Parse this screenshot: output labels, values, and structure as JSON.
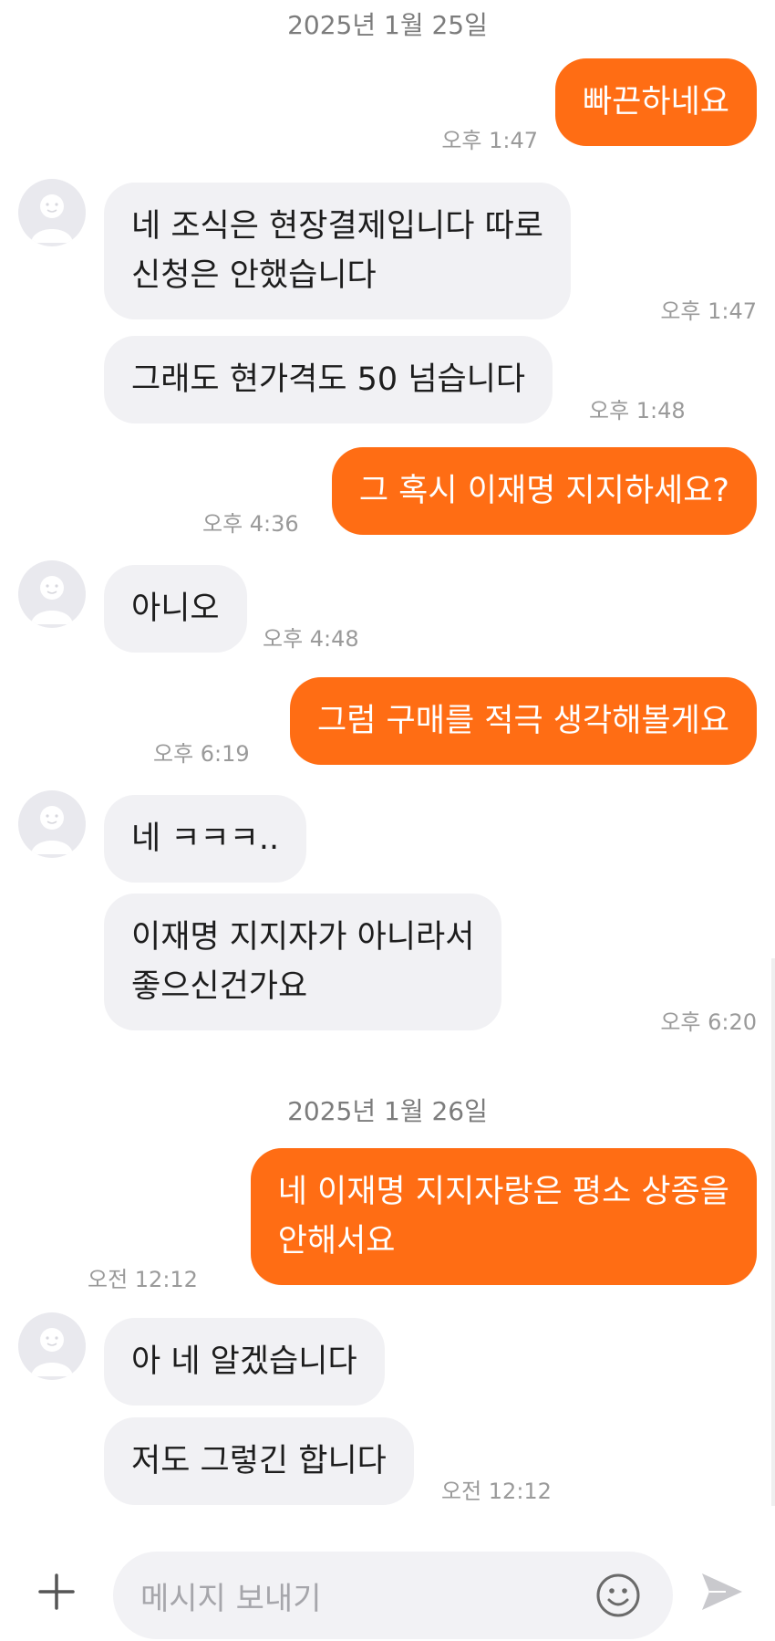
{
  "dates": {
    "first": "2025년 1월 25일",
    "second": "2025년 1월 26일"
  },
  "messages": [
    {
      "direction": "out",
      "text": "빠끈하네요",
      "time": "오후 1:47"
    },
    {
      "direction": "in",
      "text": "네 조식은 현장결제입니다 따로\n신청은 안했습니다",
      "time": "오후 1:47"
    },
    {
      "direction": "in",
      "text": "그래도 현가격도 50 넘습니다",
      "time": "오후 1:48"
    },
    {
      "direction": "out",
      "text": "그 혹시 이재명 지지하세요?",
      "time": "오후 4:36"
    },
    {
      "direction": "in",
      "text": "아니오",
      "time": "오후 4:48"
    },
    {
      "direction": "out",
      "text": "그럼 구매를 적극 생각해볼게요",
      "time": "오후 6:19"
    },
    {
      "direction": "in",
      "text": "네 ㅋㅋㅋ..",
      "time": ""
    },
    {
      "direction": "in",
      "text": "이재명 지지자가 아니라서\n좋으신건가요",
      "time": "오후 6:20"
    },
    {
      "direction": "out",
      "text": "네 이재명 지지자랑은 평소 상종을\n안해서요",
      "time": "오전 12:12"
    },
    {
      "direction": "in",
      "text": "아 네 알겠습니다",
      "time": ""
    },
    {
      "direction": "in",
      "text": "저도 그렇긴 합니다",
      "time": "오전 12:12"
    }
  ],
  "input": {
    "placeholder": "메시지 보내기"
  },
  "icons": {
    "attach": "plus-icon",
    "emoji": "smiley-icon",
    "send": "send-icon",
    "avatar": "default-avatar-icon"
  },
  "colors": {
    "outgoing_bubble": "#ff6d14",
    "incoming_bubble": "#f1f1f4",
    "timestamp": "#9a9a9a"
  }
}
